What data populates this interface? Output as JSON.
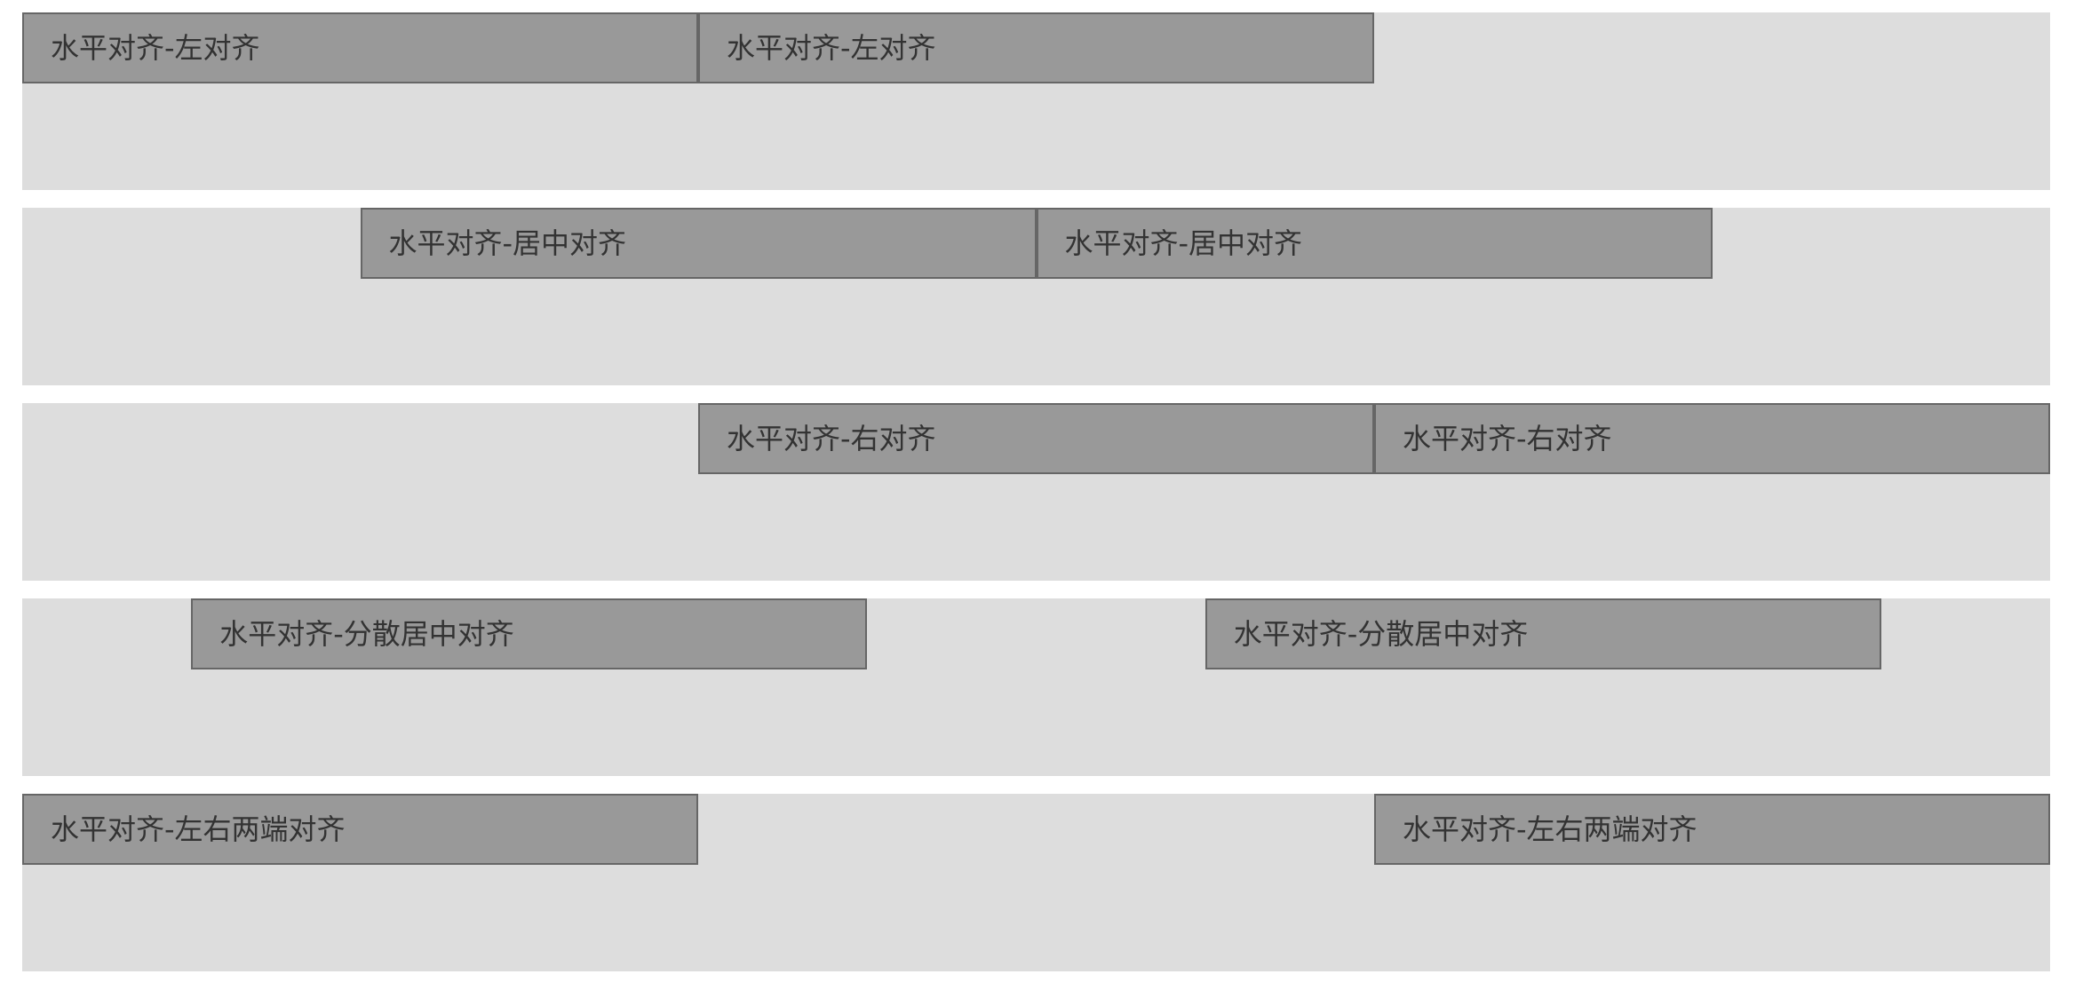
{
  "colors": {
    "page_background": "#ffffff",
    "container_background": "#dddddd",
    "item_background": "#999999",
    "item_border": "#666666",
    "item_text": "#333333"
  },
  "rows": [
    {
      "items": [
        "水平对齐-左对齐",
        "水平对齐-左对齐"
      ]
    },
    {
      "items": [
        "水平对齐-居中对齐",
        "水平对齐-居中对齐"
      ]
    },
    {
      "items": [
        "水平对齐-右对齐",
        "水平对齐-右对齐"
      ]
    },
    {
      "items": [
        "水平对齐-分散居中对齐",
        "水平对齐-分散居中对齐"
      ]
    },
    {
      "items": [
        "水平对齐-左右两端对齐",
        "水平对齐-左右两端对齐"
      ]
    }
  ]
}
